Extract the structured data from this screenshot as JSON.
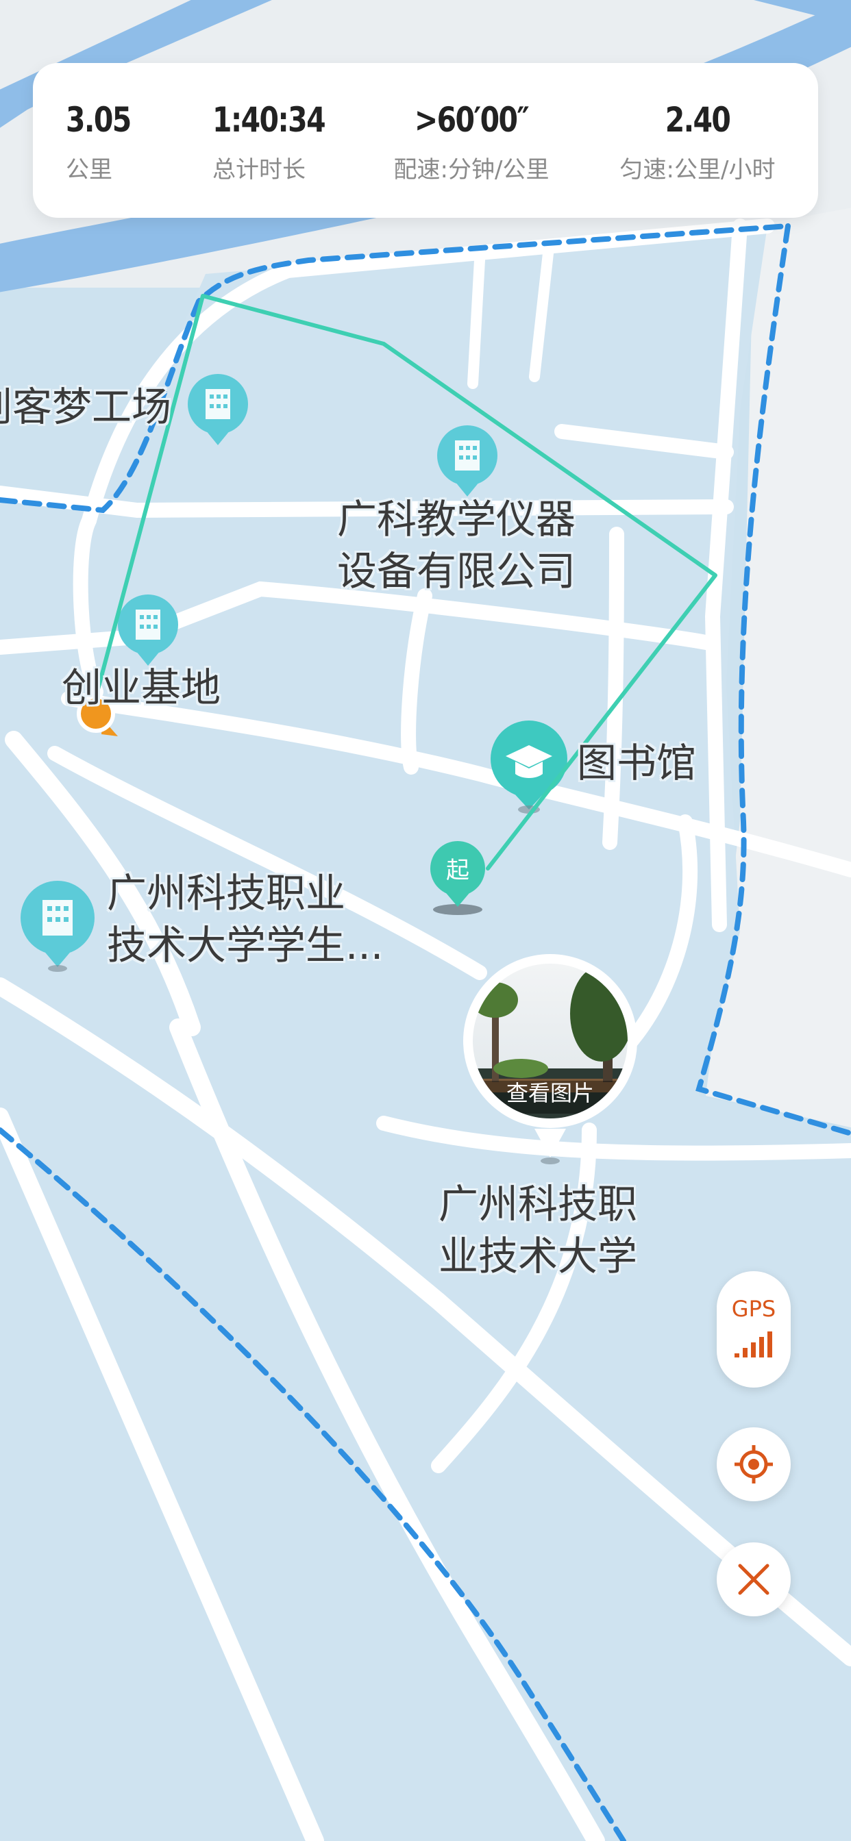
{
  "stats": {
    "distance": {
      "value": "3.05",
      "label": "公里"
    },
    "duration": {
      "value": "1:40:34",
      "label": "总计时长"
    },
    "pace": {
      "value": ">60′00″",
      "label": "配速:分钟/公里"
    },
    "speed": {
      "value": "2.40",
      "label": "匀速:公里/小时"
    }
  },
  "map": {
    "pois": [
      {
        "name": "创客梦工场",
        "display": "创客梦工场"
      },
      {
        "name": "广科教学仪器设备有限公司",
        "line1": "广科教学仪器",
        "line2": "设备有限公司"
      },
      {
        "name": "创业基地",
        "display": "创业基地"
      },
      {
        "name": "图书馆",
        "display": "图书馆"
      },
      {
        "name": "广州科技职业技术大学学生...",
        "line1": "广州科技职业",
        "line2": "技术大学学生..."
      },
      {
        "name": "广州科技职业技术大学",
        "line1": "广州科技职",
        "line2": "业技术大学"
      }
    ],
    "start_marker": "起",
    "photo_label": "查看图片",
    "route_color": "#3ecfb2",
    "current_marker_color": "#f0961e",
    "boundary_color": "#2f8fe0"
  },
  "controls": {
    "gps_label": "GPS",
    "locate_icon": "locate-icon",
    "close_icon": "close-icon",
    "accent": "#d9561a"
  }
}
